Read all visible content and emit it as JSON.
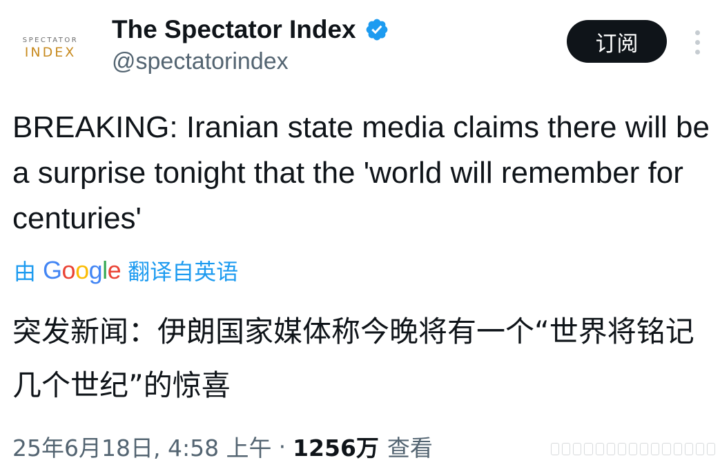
{
  "author": {
    "avatar_line1": "SPECTATOR",
    "avatar_line2": "INDEX",
    "display_name": "The Spectator Index",
    "verified_icon": "verified-badge-icon",
    "handle": "@spectatorindex"
  },
  "actions": {
    "subscribe_label": "订阅",
    "more_icon": "more-vertical-icon"
  },
  "tweet": {
    "text": "BREAKING: Iranian state media claims there will be a surprise tonight that the 'world will remember for centuries'"
  },
  "translation": {
    "prefix": "由",
    "google_g": "G",
    "google_o1": "o",
    "google_o2": "o",
    "google_g2": "g",
    "google_l": "l",
    "google_e": "e",
    "suffix": "翻译自英语",
    "text": "突发新闻：伊朗国家媒体称今晚将有一个“世界将铭记几个世纪”的惊喜"
  },
  "meta": {
    "timestamp": "25年6月18日, 4:58 上午",
    "separator": "·",
    "views_count": "1256万",
    "views_label": "查看"
  },
  "colors": {
    "link_blue": "#1d9bf0",
    "muted_text": "#536471",
    "avatar_gold": "#c78a1e"
  }
}
